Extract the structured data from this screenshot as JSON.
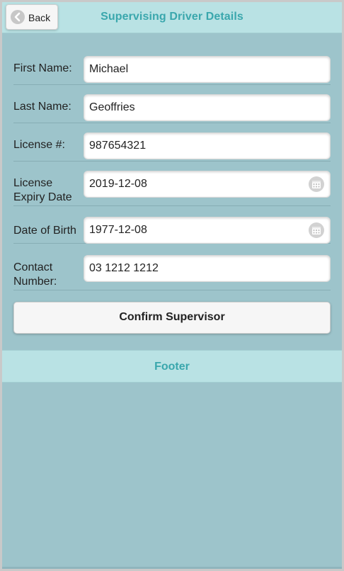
{
  "header": {
    "title": "Supervising Driver Details",
    "back_label": "Back"
  },
  "form": {
    "first_name": {
      "label": "First Name:",
      "value": "Michael"
    },
    "last_name": {
      "label": "Last Name:",
      "value": "Geoffries"
    },
    "license": {
      "label": "License #:",
      "value": "987654321"
    },
    "license_expiry": {
      "label_line1": "License",
      "label_line2": "Expiry Date",
      "value": "2019-12-08"
    },
    "dob": {
      "label": "Date of Birth",
      "value": "1977-12-08"
    },
    "contact": {
      "label_line1": "Contact",
      "label_line2": "Number:",
      "value": "03 1212 1212"
    }
  },
  "confirm_label": "Confirm Supervisor",
  "footer": {
    "title": "Footer"
  },
  "icons": {
    "back": "chevron-left-icon",
    "date_picker": "calendar-icon"
  },
  "colors": {
    "header_bg": "#b9e2e4",
    "header_text": "#3aa7ad",
    "page_bg": "#9dc4cb"
  }
}
